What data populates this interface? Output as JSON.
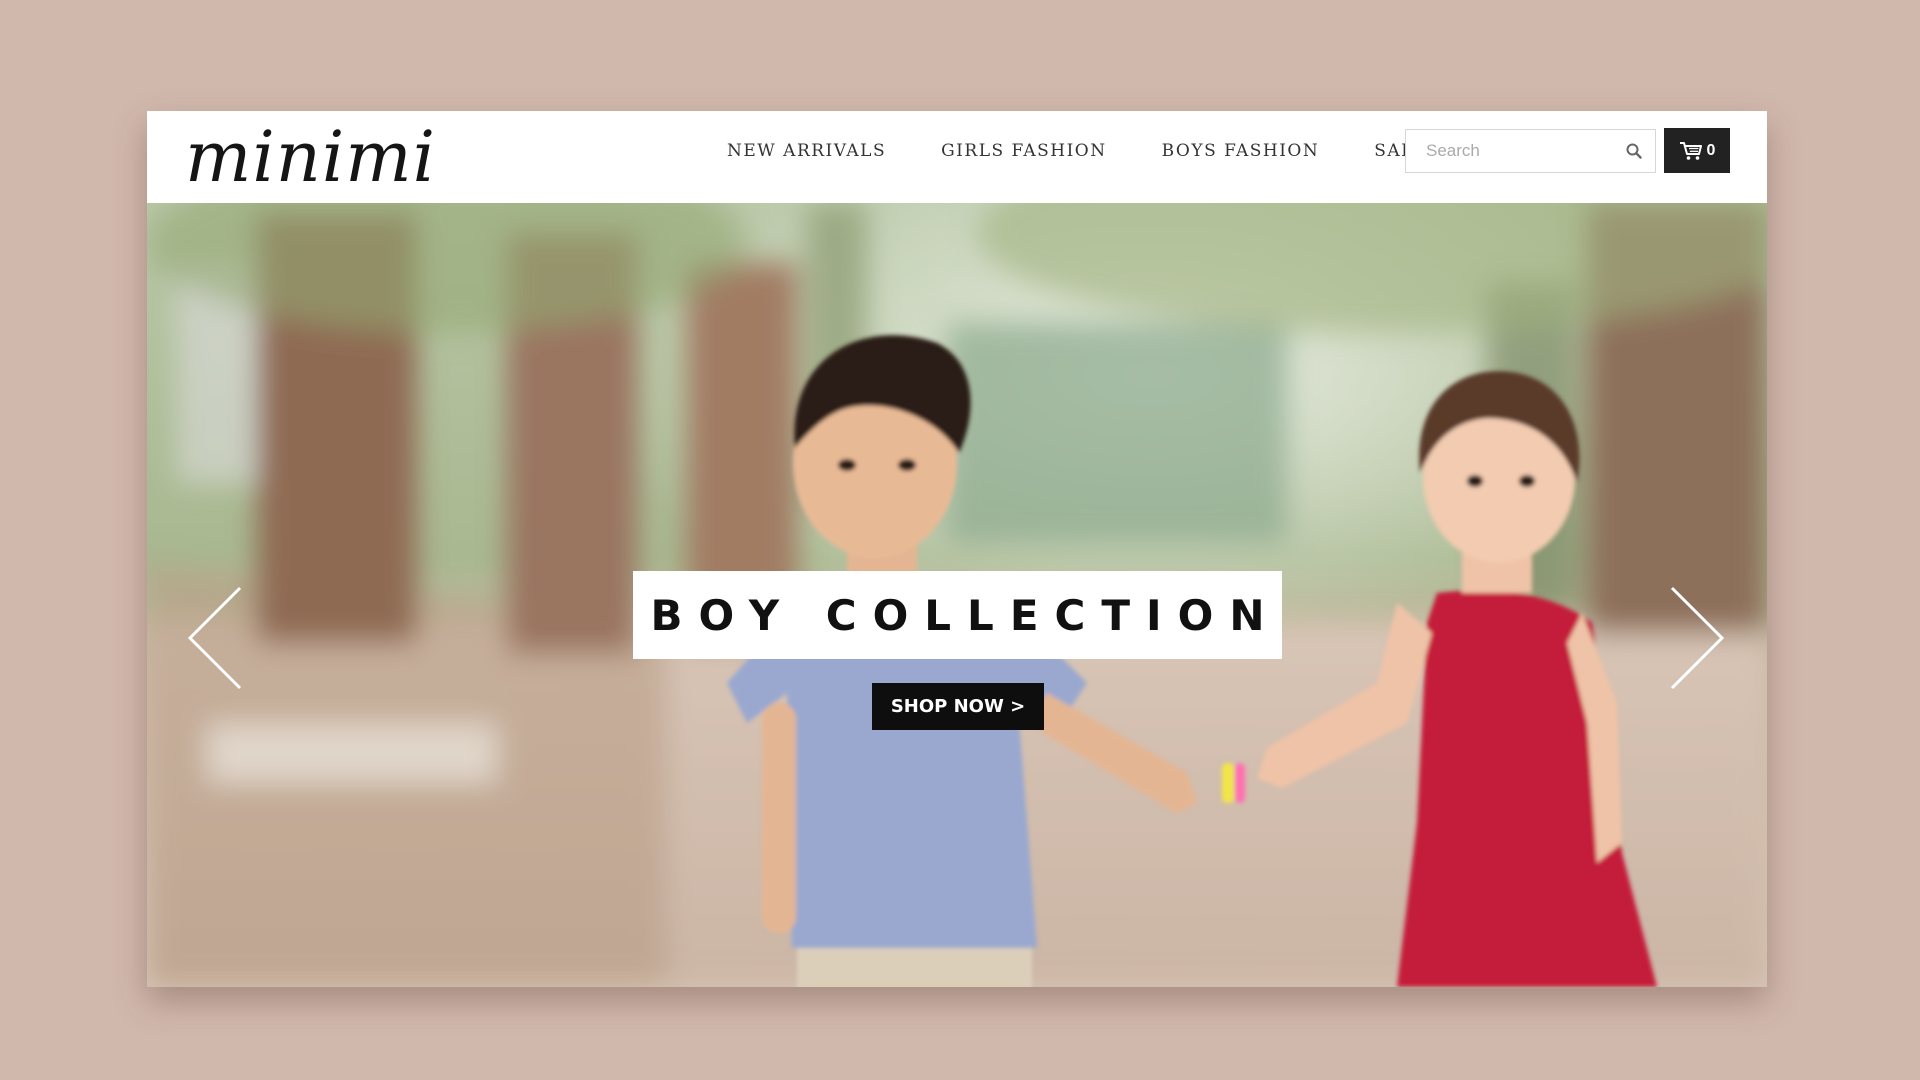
{
  "brand": {
    "logo_text": "minimi"
  },
  "nav": {
    "items": [
      {
        "label": "NEW ARRIVALS"
      },
      {
        "label": "GIRLS FASHION"
      },
      {
        "label": "BOYS FASHION"
      },
      {
        "label": "SALE"
      }
    ]
  },
  "search": {
    "placeholder": "Search",
    "value": "",
    "icon": "search-icon"
  },
  "cart": {
    "icon": "cart-icon",
    "count": "0"
  },
  "hero": {
    "title": "BOY COLLECTION",
    "cta_label": "SHOP NOW >",
    "prev_icon": "chevron-left-icon",
    "next_icon": "chevron-right-icon"
  },
  "colors": {
    "page_background": "#d1b8ac",
    "header_background": "#ffffff",
    "cart_button": "#222222",
    "cta_button": "#0e0e0e",
    "boy_shirt": "#9aa8cf",
    "girl_dress": "#c41e3a"
  }
}
